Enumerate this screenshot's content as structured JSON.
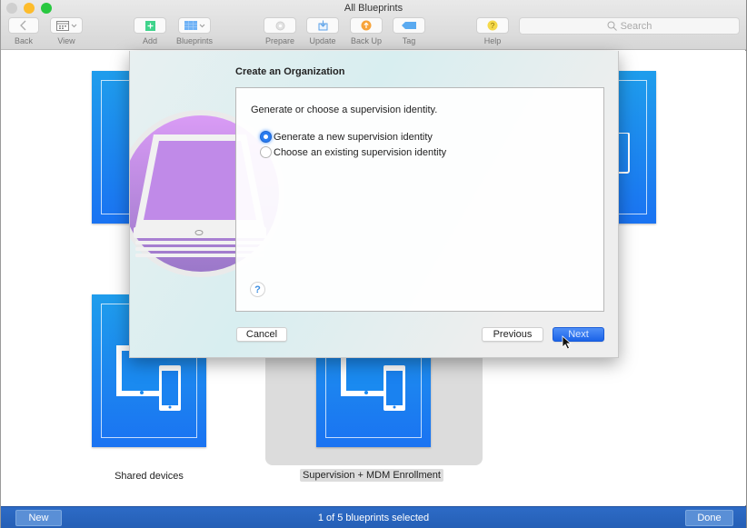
{
  "window": {
    "title": "All Blueprints",
    "traffic_lights": [
      "close",
      "minimize",
      "zoom"
    ]
  },
  "toolbar": {
    "items": [
      {
        "id": "back",
        "label": "Back",
        "icon": "chevron-left-icon"
      },
      {
        "id": "view",
        "label": "View",
        "icon": "calendar-grid-icon"
      },
      {
        "id": "add",
        "label": "Add",
        "icon": "plus-square-icon",
        "color": "#3fd38b"
      },
      {
        "id": "blueprints",
        "label": "Blueprints",
        "icon": "blueprint-grid-icon",
        "color": "#6fb2f5"
      },
      {
        "id": "prepare",
        "label": "Prepare",
        "icon": "gear-circle-icon"
      },
      {
        "id": "update",
        "label": "Update",
        "icon": "download-tray-icon",
        "color": "#5aa0e8"
      },
      {
        "id": "backup",
        "label": "Back Up",
        "icon": "up-arrow-circle-icon",
        "color": "#f7a33a"
      },
      {
        "id": "tag",
        "label": "Tag",
        "icon": "tag-icon",
        "color": "#5aaaf0"
      },
      {
        "id": "help",
        "label": "Help",
        "icon": "question-circle-icon",
        "color": "#f5d94a"
      }
    ],
    "search": {
      "placeholder": "Search",
      "icon": "magnifier-icon"
    }
  },
  "blueprints": [
    {
      "label": "",
      "selected": false
    },
    {
      "label": "",
      "selected": false
    },
    {
      "label": "Shared devices",
      "selected": false
    },
    {
      "label": "Supervision + MDM Enrollment",
      "selected": true
    }
  ],
  "dialog": {
    "title": "Create an Organization",
    "prompt": "Generate or choose a supervision identity.",
    "options": [
      {
        "label": "Generate a new supervision identity",
        "selected": true
      },
      {
        "label": "Choose an existing supervision identity",
        "selected": false
      }
    ],
    "help_icon": "?",
    "buttons": {
      "cancel": "Cancel",
      "previous": "Previous",
      "next": "Next"
    }
  },
  "bottombar": {
    "new_label": "New",
    "status": "1 of 5 blueprints selected",
    "done_label": "Done"
  }
}
